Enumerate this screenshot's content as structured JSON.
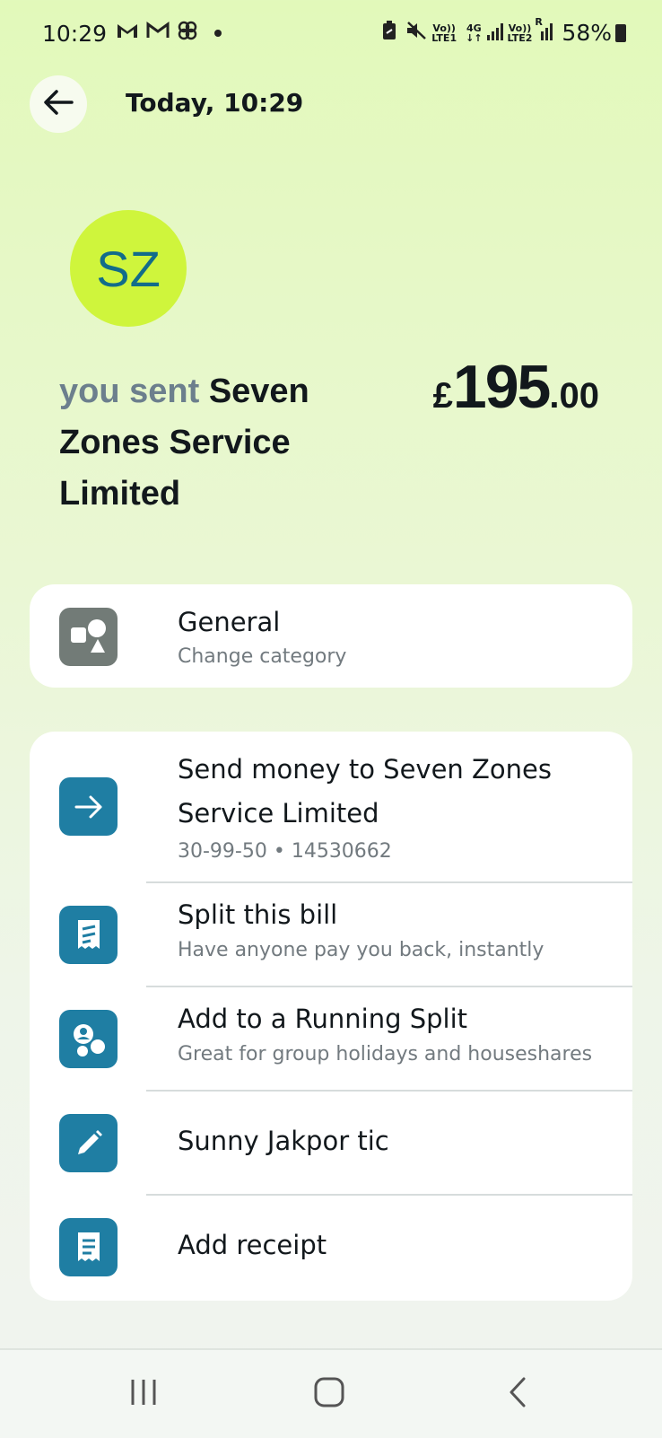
{
  "status_bar": {
    "time": "10:29",
    "battery": "58%",
    "notif_icons": [
      "gmail-icon",
      "gmail-outline-icon",
      "fan-icon",
      "dot-icon"
    ],
    "sys_icons": [
      "battery-saver-icon",
      "mute-icon",
      "volte-lte1-icon",
      "4g-icon",
      "signal-icon",
      "volte-lte2-icon",
      "signal-roaming-icon",
      "battery-icon"
    ],
    "lte1_line1": "Vo))",
    "lte1_line2": "LTE1",
    "g4_line1": "4G",
    "g4_line2": "↓↑",
    "lte2_line1": "Vo))",
    "lte2_line2": "LTE2",
    "roaming": "R"
  },
  "header": {
    "title": "Today, 10:29",
    "back_icon": "arrow-left-icon"
  },
  "avatar": {
    "initials": "SZ",
    "bg": "#cff53c",
    "fg": "#126c8a"
  },
  "payee": {
    "prefix": "you sent",
    "name": "Seven Zones Service Limited"
  },
  "amount": {
    "currency": "£",
    "major": "195",
    "minor": ".00"
  },
  "category": {
    "title": "General",
    "subtitle": "Change category",
    "icon": "shapes-icon"
  },
  "actions": [
    {
      "title": "Send money to Seven Zones Service Limited",
      "subtitle": "30-99-50 • 14530662",
      "icon": "arrow-right-icon"
    },
    {
      "title": "Split this bill",
      "subtitle": "Have anyone pay you back, instantly",
      "icon": "split-bill-icon"
    },
    {
      "title": "Add to a Running Split",
      "subtitle": "Great for group holidays and houseshares",
      "icon": "group-icon"
    },
    {
      "title": "Sunny Jakpor tic",
      "subtitle": "",
      "icon": "pencil-icon"
    },
    {
      "title": "Add receipt",
      "subtitle": "",
      "icon": "receipt-icon"
    }
  ],
  "colors": {
    "accent": "#1f7ea3",
    "lime": "#cff53c"
  },
  "nav_bar": {
    "buttons": [
      "recents-icon",
      "home-icon",
      "back-icon"
    ]
  }
}
